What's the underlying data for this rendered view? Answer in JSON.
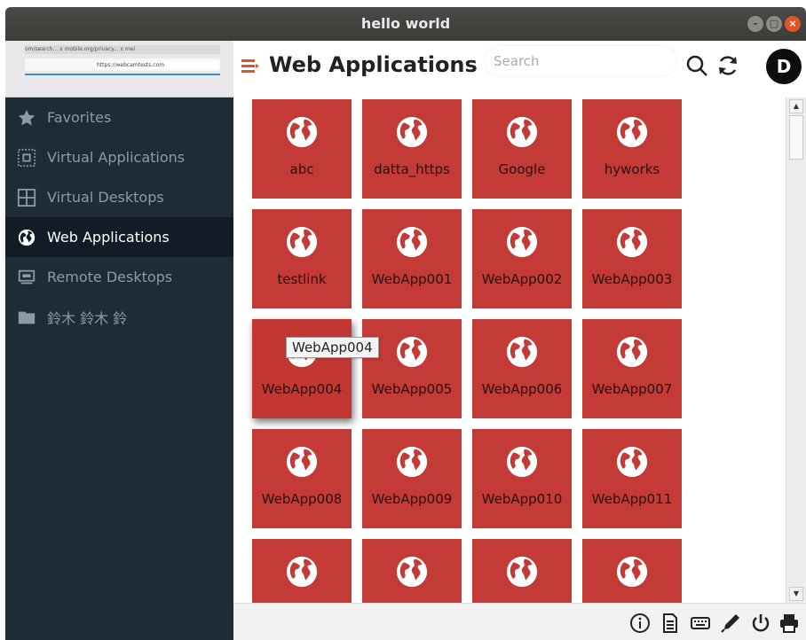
{
  "window": {
    "title": "hello world"
  },
  "sidebar": {
    "thumbnail": {
      "tabs_text": "om/search... x  mobile.org/privacy... x  mei",
      "url_text": "https://webcamtests.com"
    },
    "items": [
      {
        "label": "Favorites",
        "icon": "star-icon",
        "active": false
      },
      {
        "label": "Virtual Applications",
        "icon": "virtual-app-icon",
        "active": false
      },
      {
        "label": "Virtual Desktops",
        "icon": "grid-icon",
        "active": false
      },
      {
        "label": "Web Applications",
        "icon": "globe-icon",
        "active": true
      },
      {
        "label": "Remote Desktops",
        "icon": "monitor-icon",
        "active": false
      },
      {
        "label": "鈴木 鈴木 鈴",
        "icon": "folder-icon",
        "active": false
      }
    ]
  },
  "header": {
    "title": "Web Applications",
    "search_placeholder": "Search",
    "avatar_initial": "D"
  },
  "apps": [
    "abc",
    "datta_https",
    "Google",
    "hyworks",
    "testlink",
    "WebApp001",
    "WebApp002",
    "WebApp003",
    "WebApp004",
    "WebApp005",
    "WebApp006",
    "WebApp007",
    "WebApp008",
    "WebApp009",
    "WebApp010",
    "WebApp011",
    "",
    "",
    "",
    ""
  ],
  "tooltip": "WebApp004",
  "colors": {
    "tile": "#c43a36",
    "sidebar": "#1f2c38",
    "sidebar_active": "#111c26",
    "accent": "#e0542a"
  }
}
